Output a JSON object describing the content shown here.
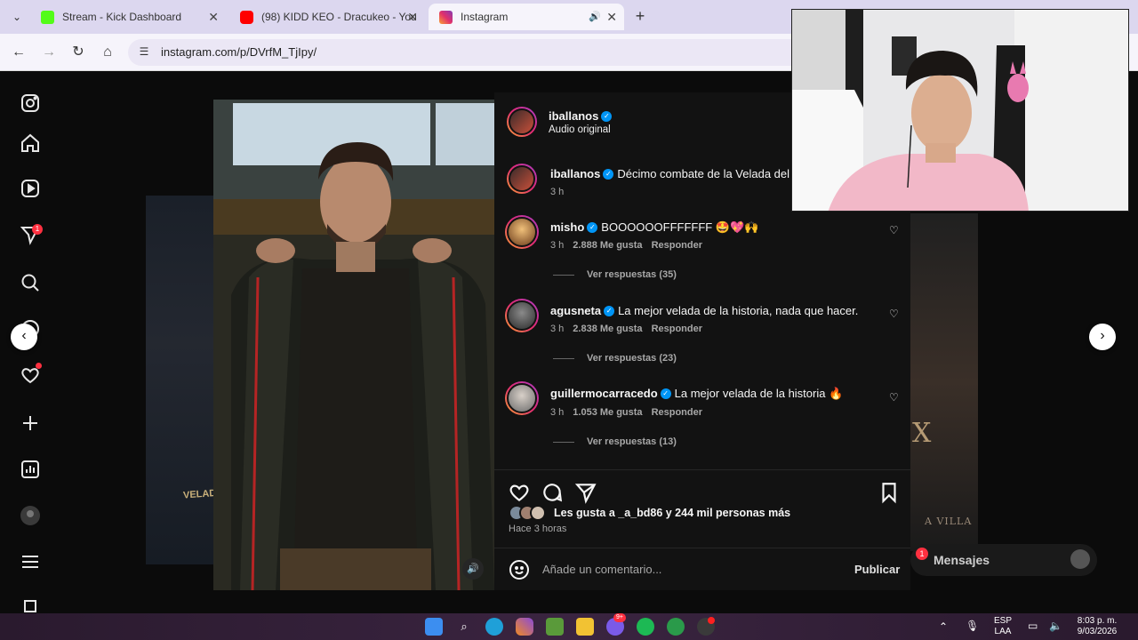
{
  "browser": {
    "tabs": [
      {
        "title": "Stream - Kick Dashboard",
        "favicon_color": "#53fc18"
      },
      {
        "title": "(98) KIDD KEO - Dracukeo - You",
        "favicon_color": "#ff0000"
      },
      {
        "title": "Instagram",
        "favicon_color": "#e1306c"
      }
    ],
    "url": "instagram.com/p/DVrfM_TjIpy/"
  },
  "sidebar": {
    "notifications_badge": "1"
  },
  "post": {
    "author": "iballanos",
    "audio": "Audio original",
    "caption": {
      "user": "iballanos",
      "text": "Décimo combate de la Velada del",
      "time": "3 h"
    },
    "comments": [
      {
        "user": "misho",
        "text": "BOOOOOOFFFFFFF 🤩💖🙌",
        "time": "3 h",
        "likes": "2.888 Me gusta",
        "reply": "Responder",
        "replies": "Ver respuestas (35)"
      },
      {
        "user": "agusneta",
        "text": "La mejor velada de la historia, nada que hacer.",
        "time": "3 h",
        "likes": "2.838 Me gusta",
        "reply": "Responder",
        "replies": "Ver respuestas (23)"
      },
      {
        "user": "guillermocarracedo",
        "text": "La mejor velada de la historia 🔥",
        "time": "3 h",
        "likes": "1.053 Me gusta",
        "reply": "Responder",
        "replies": "Ver respuestas (13)"
      }
    ],
    "likes_text": "Les gusta a _a_bd86 y 244 mil personas más",
    "posted_ago": "Hace 3 horas",
    "comment_placeholder": "Añade un comentario...",
    "publish": "Publicar"
  },
  "background": {
    "velada_text": "VELADA",
    "x_text": "X",
    "villa_text": "A VILLA",
    "messages_label": "Mensajes",
    "messages_badge": "1"
  },
  "taskbar": {
    "lang_top": "ESP",
    "lang_bottom": "LAA",
    "time": "8:03 p. m.",
    "date": "9/03/2026",
    "badge": "9+"
  },
  "colors": {
    "accent_blue": "#0095f6",
    "notification_red": "#ff3040"
  }
}
